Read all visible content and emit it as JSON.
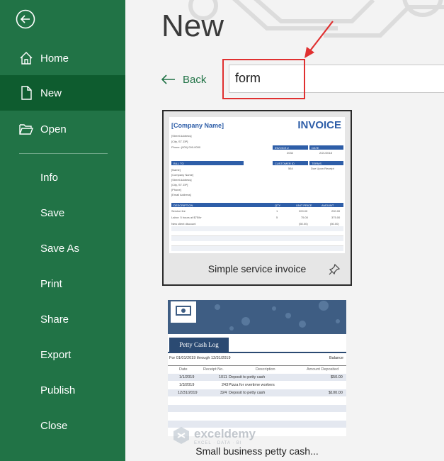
{
  "sidebar": {
    "nav": [
      {
        "label": "Home",
        "icon": "home-icon"
      },
      {
        "label": "New",
        "icon": "new-document-icon",
        "active": true
      },
      {
        "label": "Open",
        "icon": "open-folder-icon"
      }
    ],
    "sub": [
      "Info",
      "Save",
      "Save As",
      "Print",
      "Share",
      "Export",
      "Publish",
      "Close"
    ]
  },
  "header": {
    "title": "New"
  },
  "back": {
    "label": "Back"
  },
  "search": {
    "value": "form"
  },
  "templates": [
    {
      "name": "Simple service invoice",
      "thumb": {
        "company": "[Company Name]",
        "title": "INVOICE",
        "address": [
          "[Street Address]",
          "[City, ST ZIP]",
          "Phone: (000) 000-0000"
        ],
        "invoice_no_label": "INVOICE #",
        "date_label": "DATE",
        "invoice_no": "2034",
        "date": "2/21/2018",
        "customer_id_label": "CUSTOMER ID",
        "terms_label": "TERMS",
        "customer_id": "564",
        "terms": "Due Upon Receipt",
        "bill_to_label": "BILL TO",
        "bill_to": [
          "[Name]",
          "[Company Name]",
          "[Street Address]",
          "[City, ST ZIP]",
          "[Phone]",
          "[Email Address]"
        ],
        "table_headers": [
          "DESCRIPTION",
          "QTY",
          "UNIT PRICE",
          "AMOUNT"
        ],
        "rows": [
          [
            "Service fee",
            "1",
            "200.00",
            "200.00"
          ],
          [
            "Labor: 5 hours at $75/hr",
            "5",
            "75.00",
            "375.00"
          ],
          [
            "New client discount",
            "",
            "(50.00)",
            "(50.00)"
          ]
        ]
      }
    },
    {
      "name": "Small business petty cash...",
      "thumb": {
        "tab": "Petty Cash Log",
        "period": "For 01/01/2019 through 12/31/2019",
        "balance_label": "Balance",
        "headers": [
          "Date",
          "Receipt No.",
          "Description",
          "Amount Deposited"
        ],
        "rows": [
          [
            "1/1/2019",
            "1011",
            "Deposit to petty cash",
            "$50.00"
          ],
          [
            "1/3/2019",
            "243",
            "Pizza for overtime workers",
            ""
          ],
          [
            "12/31/2019",
            "324",
            "Deposit to petty cash",
            "$100.00"
          ]
        ]
      }
    }
  ],
  "watermark": {
    "name": "exceldemy",
    "tagline": "EXCEL · DATA · BI"
  },
  "colors": {
    "sidebar": "#217346",
    "sidebar_active": "#0e5c2f",
    "accent": "#217346",
    "highlight": "#e03030",
    "invoice_blue": "#2e5ea8"
  }
}
